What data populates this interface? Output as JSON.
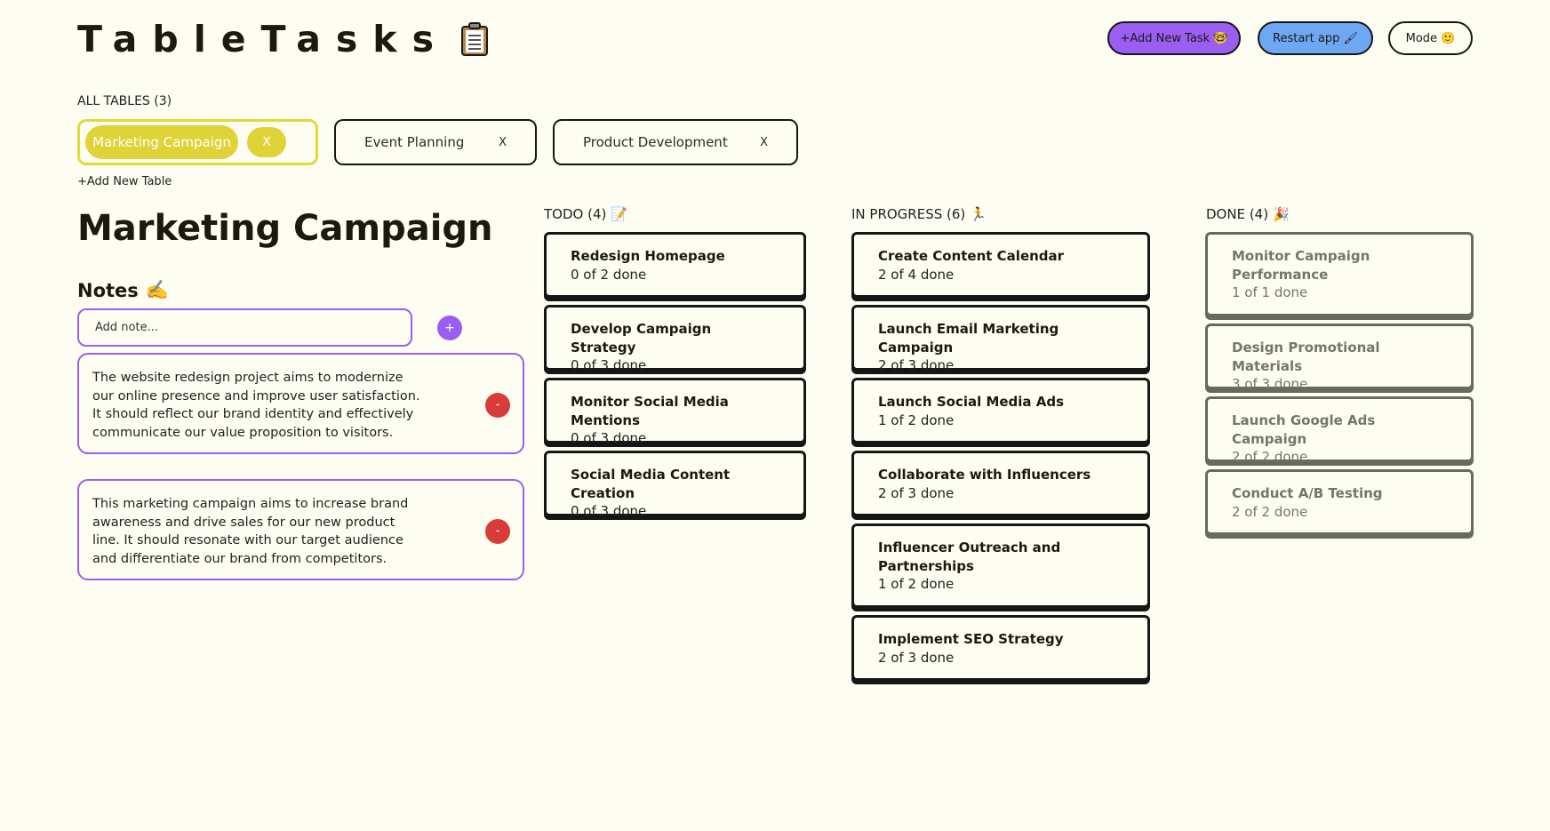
{
  "app": {
    "title": "TableTasks",
    "logo_icon": "clipboard-icon"
  },
  "header": {
    "add_task_label": "+Add New Task 🤓",
    "restart_label": "Restart app 🖌",
    "mode_label": "Mode 🙂"
  },
  "tables": {
    "heading": "ALL TABLES (3)",
    "items": [
      {
        "label": "Marketing Campaign",
        "close": "X",
        "active": true
      },
      {
        "label": "Event Planning",
        "close": "X",
        "active": false
      },
      {
        "label": "Product Development",
        "close": "X",
        "active": false
      }
    ],
    "add_label": "+Add New Table"
  },
  "main": {
    "title": "Marketing Campaign"
  },
  "notes": {
    "title": "Notes",
    "title_icon": "✍️",
    "placeholder": "Add note...",
    "add_label": "+",
    "delete_label": "-",
    "items": [
      "The website redesign project aims to modernize our online presence and improve user satisfaction. It should reflect our brand identity and effectively communicate our value proposition to visitors.",
      "This marketing campaign aims to increase brand awareness and drive sales for our new product line. It should resonate with our target audience and differentiate our brand from competitors."
    ]
  },
  "columns": {
    "todo": {
      "heading": "TODO (4)",
      "icon": "📝",
      "cards": [
        {
          "title": "Redesign Homepage",
          "progress": "0 of 2 done"
        },
        {
          "title": "Develop Campaign Strategy",
          "progress": "0 of 3 done"
        },
        {
          "title": "Monitor Social Media Mentions",
          "progress": "0 of 3 done"
        },
        {
          "title": "Social Media Content Creation",
          "progress": "0 of 3 done"
        }
      ]
    },
    "in_progress": {
      "heading": "IN PROGRESS (6)",
      "icon": "🏃",
      "cards": [
        {
          "title": "Create Content Calendar",
          "progress": "2 of 4 done"
        },
        {
          "title": "Launch Email Marketing Campaign",
          "progress": "2 of 3 done"
        },
        {
          "title": "Launch Social Media Ads",
          "progress": "1 of 2 done"
        },
        {
          "title": "Collaborate with Influencers",
          "progress": "2 of 3 done"
        },
        {
          "title": "Influencer Outreach and Partnerships",
          "progress": "1 of 2 done"
        },
        {
          "title": "Implement SEO Strategy",
          "progress": "2 of 3 done"
        }
      ]
    },
    "done": {
      "heading": "DONE (4)",
      "icon": "🎉",
      "cards": [
        {
          "title": "Monitor Campaign Performance",
          "progress": "1 of 1 done"
        },
        {
          "title": "Design Promotional Materials",
          "progress": "3 of 3 done"
        },
        {
          "title": "Launch Google Ads Campaign",
          "progress": "2 of 2 done"
        },
        {
          "title": "Conduct A/B Testing",
          "progress": "2 of 2 done"
        }
      ]
    }
  },
  "colors": {
    "background": "#fefdf2",
    "accent_purple": "#9a5ef0",
    "accent_blue": "#6fa8f2",
    "active_tab_yellow": "#dfd337",
    "delete_red": "#d93a3a",
    "done_gray": "#747668"
  }
}
